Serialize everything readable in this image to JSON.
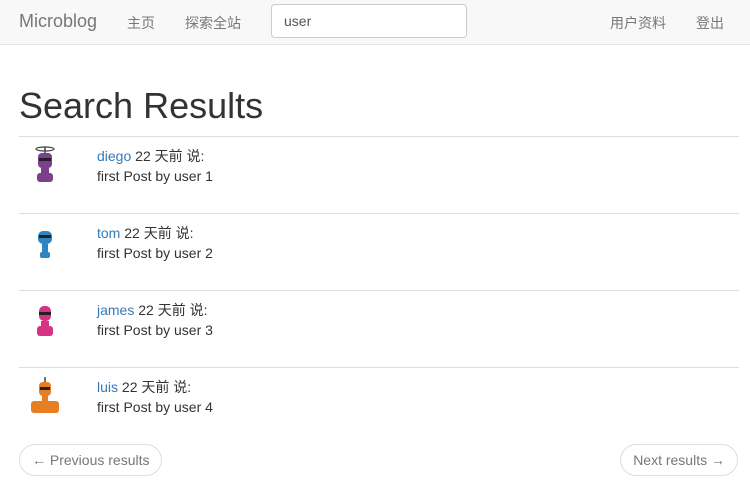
{
  "nav": {
    "brand": "Microblog",
    "home": "主页",
    "explore": "探索全站",
    "search_value": "user",
    "profile": "用户资料",
    "logout": "登出"
  },
  "page": {
    "title": "Search Results"
  },
  "results": [
    {
      "username": "diego",
      "meta": " 22 天前 说:",
      "body": "first Post by user 1",
      "avatar_color": "#7b3f8c"
    },
    {
      "username": "tom",
      "meta": " 22 天前 说:",
      "body": "first Post by user 2",
      "avatar_color": "#2e86c1"
    },
    {
      "username": "james",
      "meta": " 22 天前 说:",
      "body": "first Post by user 3",
      "avatar_color": "#d63384"
    },
    {
      "username": "luis",
      "meta": " 22 天前 说:",
      "body": "first Post by user 4",
      "avatar_color": "#e67e22"
    }
  ],
  "pager": {
    "prev_label": "← Previous results",
    "next_label": "Next results →"
  }
}
